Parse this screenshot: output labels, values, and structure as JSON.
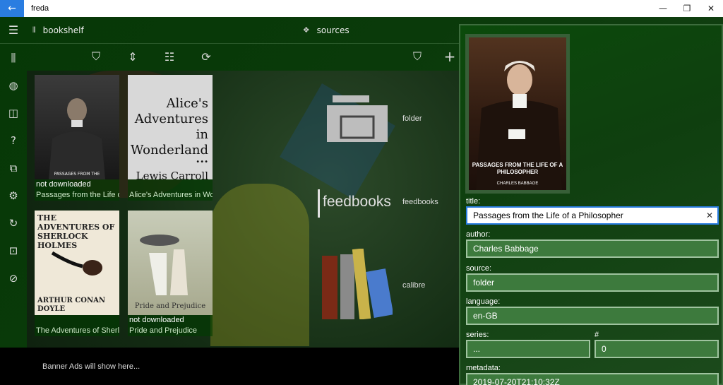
{
  "window": {
    "title": "freda",
    "back_glyph": "←",
    "minimize": "—",
    "maximize": "❐",
    "close": "✕"
  },
  "header": {
    "bookshelf_label": "bookshelf",
    "sources_label": "sources"
  },
  "books": [
    {
      "status": "not downloaded",
      "title": "Passages from the Life of a Philosopher",
      "cover_caption": "PASSAGES FROM THE"
    },
    {
      "status": "",
      "title": "Alice's Adventures in Wonderland",
      "cover_heading": "Alice's Adventures in Wonderland",
      "cover_dots": "•••",
      "cover_author": "Lewis Carroll"
    },
    {
      "status": "",
      "title": "The Adventures of Sherlock Holmes",
      "cover_heading": "THE ADVENTURES OF SHERLOCK HOLMES",
      "cover_author": "ARTHUR CONAN DOYLE"
    },
    {
      "status": "not downloaded",
      "title": "Pride and Prejudice",
      "cover_heading": "Pride and Prejudice"
    }
  ],
  "sources": [
    {
      "name": "folder"
    },
    {
      "name": "feedbooks",
      "logo_text": "feedbooks"
    },
    {
      "name": "calibre"
    }
  ],
  "banner": {
    "text": "Banner Ads will show here..."
  },
  "details": {
    "cover_title": "PASSAGES FROM THE LIFE OF A PHILOSOPHER",
    "cover_author": "CHARLES BABBAGE",
    "fields": {
      "title_label": "title:",
      "title_value": "Passages from the Life of a Philosopher",
      "author_label": "author:",
      "author_value": "Charles Babbage",
      "source_label": "source:",
      "source_value": "folder",
      "language_label": "language:",
      "language_value": "en-GB",
      "series_label": "series:",
      "series_value": "...",
      "number_label": "#",
      "number_value": "0",
      "metadata_label": "metadata:",
      "metadata_value": "2019-07-20T21:10:32Z"
    }
  },
  "colors": {
    "accent": "#2a7de1",
    "field_bg": "#3d7a3d",
    "panel_border": "#3d6c3d"
  }
}
